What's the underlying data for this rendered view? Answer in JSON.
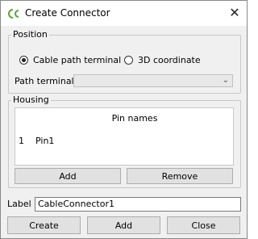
{
  "window": {
    "title": "Create Connector",
    "close_glyph": "✕"
  },
  "position": {
    "legend": "Position",
    "option_cable_path": "Cable path terminal",
    "option_3d": "3D coordinate",
    "selected": "Cable path terminal",
    "path_terminal_label": "Path terminal",
    "path_terminal_value": ""
  },
  "housing": {
    "legend": "Housing",
    "table": {
      "header": "Pin names",
      "rows": [
        {
          "num": "1",
          "name": "Pin1"
        }
      ]
    },
    "add_label": "Add",
    "remove_label": "Remove"
  },
  "label_field": {
    "label": "Label",
    "value": "CableConnector1"
  },
  "footer": {
    "create_label": "Create",
    "add_label": "Add",
    "close_label": "Close"
  },
  "colors": {
    "brand_icon": "#5aa23c",
    "window_bg": "#f0f0f0"
  }
}
